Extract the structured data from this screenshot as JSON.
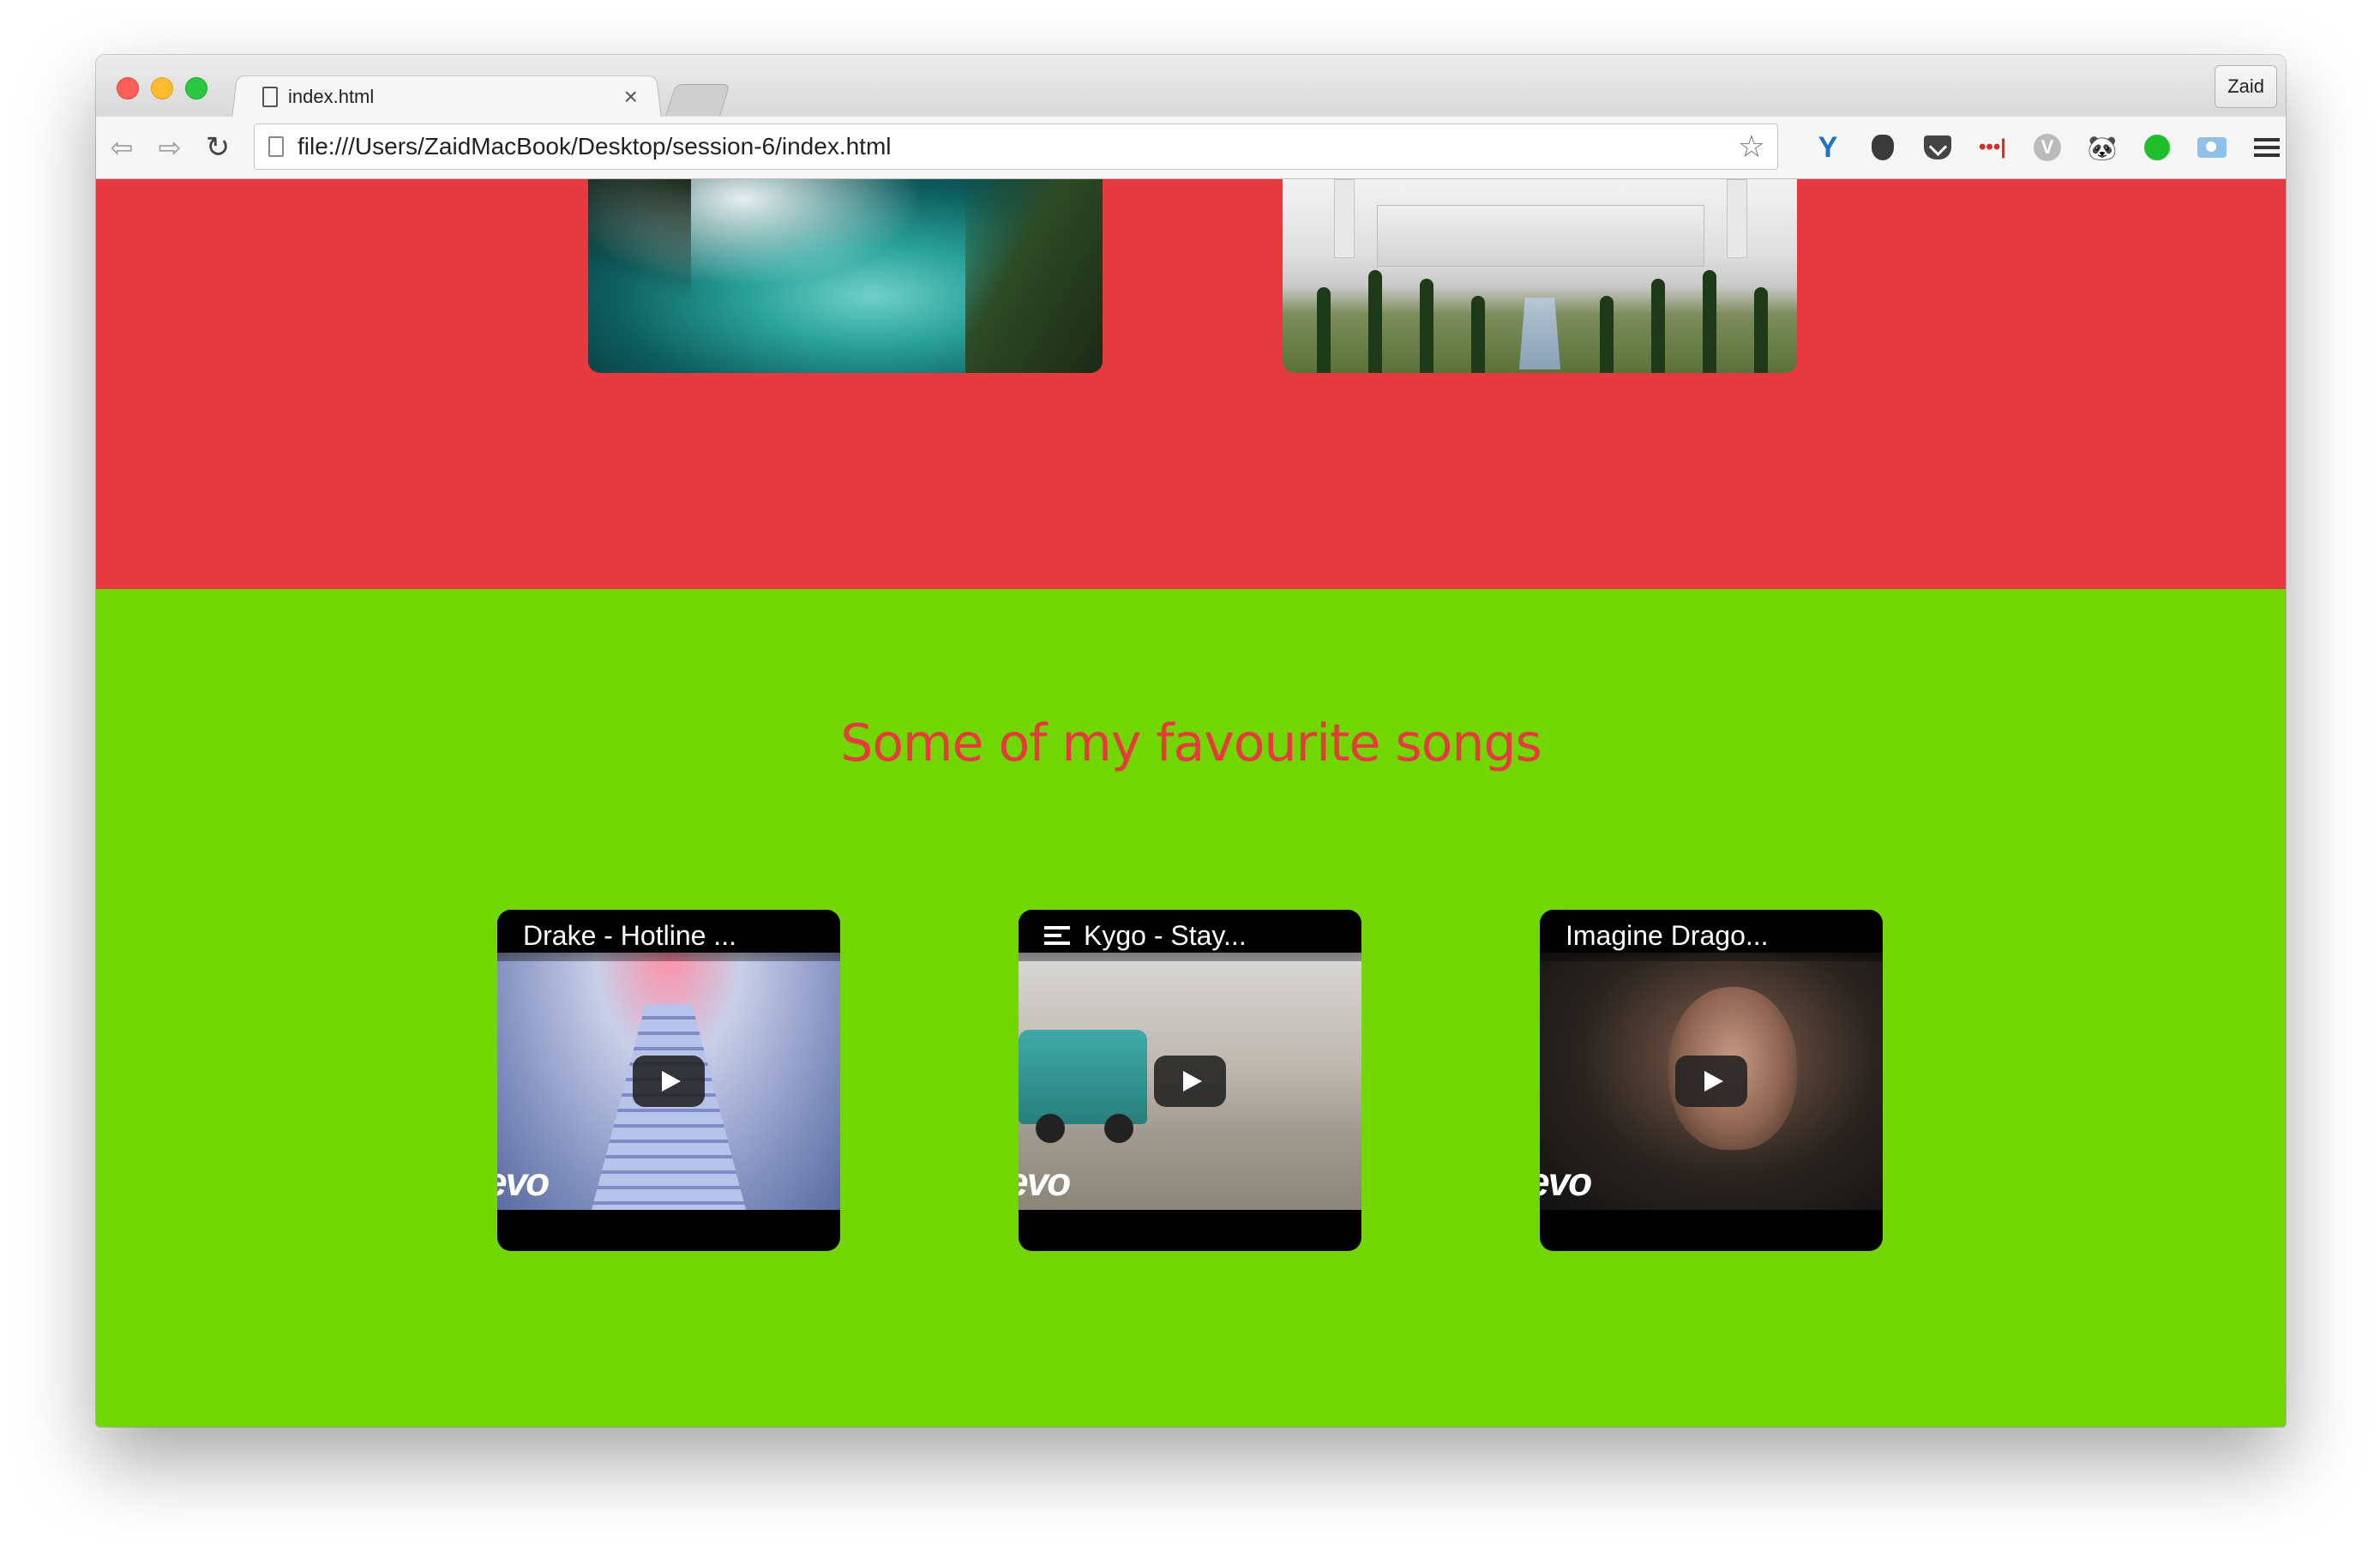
{
  "browser": {
    "tab_title": "index.html",
    "tab_close": "×",
    "profile_name": "Zaid",
    "url": "file:///Users/ZaidMacBook/Desktop/session-6/index.html",
    "back_glyph": "⇦",
    "forward_glyph": "⇨",
    "reload_glyph": "↻",
    "star_glyph": "☆",
    "extensions": [
      {
        "name": "yoast-icon",
        "glyph": "Y",
        "color": "#1a75c9"
      },
      {
        "name": "ghostery-icon",
        "glyph": "",
        "color": "#3a3a3a"
      },
      {
        "name": "pocket-icon",
        "glyph": "",
        "color": "#444444"
      },
      {
        "name": "lastpass-icon",
        "glyph": "•••|",
        "color": "#d32d27"
      },
      {
        "name": "vimeo-icon",
        "glyph": "V",
        "color": "#bbbbbb"
      },
      {
        "name": "panda-icon",
        "glyph": "🐼",
        "color": "#222222"
      },
      {
        "name": "status-green-icon",
        "glyph": "",
        "color": "#1fbf2b"
      },
      {
        "name": "screenshot-camera-icon",
        "glyph": "",
        "color": "#8fc1e8"
      },
      {
        "name": "chrome-menu-icon",
        "glyph": "",
        "color": "#333333"
      }
    ]
  },
  "page": {
    "colors": {
      "red_section": "#e63a40",
      "green_section": "#72d600",
      "title": "#e63a40"
    },
    "photos": [
      {
        "name": "niagara-falls-photo"
      },
      {
        "name": "taj-mahal-photo"
      }
    ],
    "songs_section": {
      "title": "Some of my favourite songs",
      "videos": [
        {
          "title": "Drake - Hotline ...",
          "playlist": false,
          "brand": "evo"
        },
        {
          "title": "Kygo - Stay...",
          "playlist": true,
          "brand": "evo"
        },
        {
          "title": "Imagine Drago...",
          "playlist": false,
          "brand": "evo"
        }
      ]
    }
  }
}
